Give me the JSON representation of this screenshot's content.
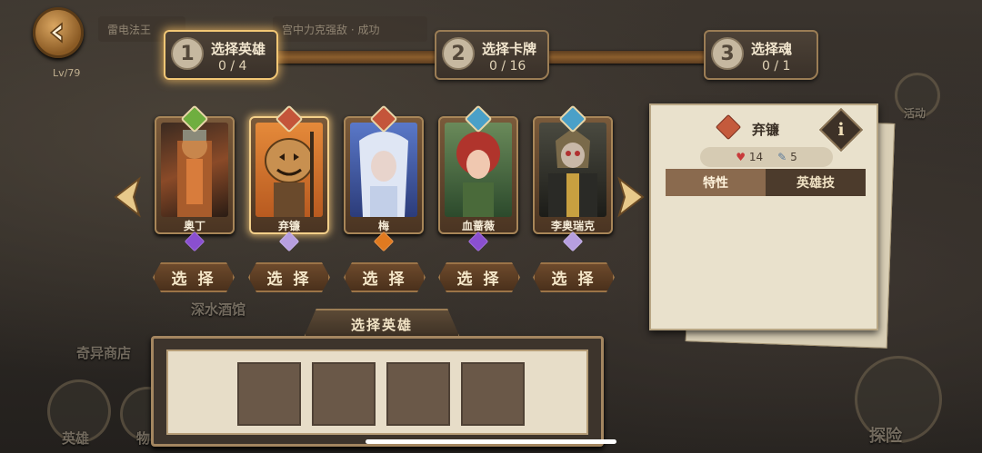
{
  "background": {
    "labels": [
      "深水酒馆",
      "奇异商店",
      "英雄",
      "探险",
      "物"
    ],
    "top_items": [
      "雷电法王",
      "宫中力克强敌 · 成功"
    ],
    "level": "Lv/79",
    "side_label": "活动"
  },
  "steps": [
    {
      "num": "1",
      "title": "选择英雄",
      "count": "0 / 4"
    },
    {
      "num": "2",
      "title": "选择卡牌",
      "count": "0 / 16"
    },
    {
      "num": "3",
      "title": "选择魂",
      "count": "0 / 1"
    }
  ],
  "heroes": [
    {
      "name": "奥丁",
      "element_color": "#6fae3f",
      "rank_color": "#8a4fd0"
    },
    {
      "name": "弃镰",
      "element_color": "#c4553a",
      "rank_color": "#b79fe0"
    },
    {
      "name": "梅",
      "element_color": "#c4553a",
      "rank_color": "#e07a20"
    },
    {
      "name": "血蔷薇",
      "element_color": "#4aa0c8",
      "rank_color": "#8a4fd0"
    },
    {
      "name": "李奥瑞克",
      "element_color": "#4aa0c8",
      "rank_color": "#b79fe0"
    }
  ],
  "select_label": "选 择",
  "bottom": {
    "title": "选择英雄"
  },
  "detail": {
    "name": "弃镰",
    "hp": "14",
    "cost": "5",
    "tab_traits": "特性",
    "tab_skill": "英雄技",
    "info": "i"
  },
  "colors": {
    "accent": "#f2c775",
    "panel": "#e9e1cc"
  }
}
